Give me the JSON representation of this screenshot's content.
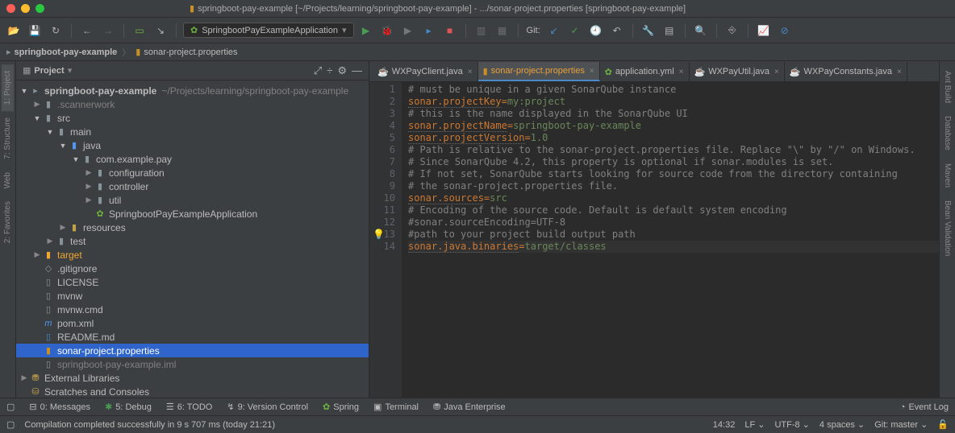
{
  "window": {
    "title": "springboot-pay-example [~/Projects/learning/springboot-pay-example] - .../sonar-project.properties [springboot-pay-example]"
  },
  "runConfig": "SpringbootPayExampleApplication",
  "gitLabel": "Git:",
  "breadcrumb": {
    "root": "springboot-pay-example",
    "file": "sonar-project.properties"
  },
  "sidebar": {
    "title": "Project",
    "tree": {
      "project": "springboot-pay-example",
      "projectPath": "~/Projects/learning/springboot-pay-example",
      "scannerwork": ".scannerwork",
      "src": "src",
      "main": "main",
      "java": "java",
      "pkg": "com.example.pay",
      "configuration": "configuration",
      "controller": "controller",
      "util": "util",
      "app": "SpringbootPayExampleApplication",
      "resources": "resources",
      "test": "test",
      "target": "target",
      "gitignore": ".gitignore",
      "license": "LICENSE",
      "mvnw": "mvnw",
      "mvnwcmd": "mvnw.cmd",
      "pom": "pom.xml",
      "readme": "README.md",
      "sonar": "sonar-project.properties",
      "iml": "springboot-pay-example.iml",
      "extlib": "External Libraries",
      "scratches": "Scratches and Consoles"
    }
  },
  "tabs": [
    {
      "label": "WXPayClient.java"
    },
    {
      "label": "sonar-project.properties"
    },
    {
      "label": "application.yml"
    },
    {
      "label": "WXPayUtil.java"
    },
    {
      "label": "WXPayConstants.java"
    }
  ],
  "editor": {
    "lines": [
      {
        "n": 1,
        "type": "comment",
        "text": "# must be unique in a given SonarQube instance"
      },
      {
        "n": 2,
        "type": "kv",
        "key": "sonar.projectKey",
        "val": "my:project"
      },
      {
        "n": 3,
        "type": "comment",
        "text": "# this is the name displayed in the SonarQube UI"
      },
      {
        "n": 4,
        "type": "kv",
        "key": "sonar.projectName",
        "val": "springboot-pay-example"
      },
      {
        "n": 5,
        "type": "kv",
        "key": "sonar.projectVersion",
        "val": "1.0"
      },
      {
        "n": 6,
        "type": "comment",
        "text": "# Path is relative to the sonar-project.properties file. Replace \"\\\" by \"/\" on Windows."
      },
      {
        "n": 7,
        "type": "comment",
        "text": "# Since SonarQube 4.2, this property is optional if sonar.modules is set."
      },
      {
        "n": 8,
        "type": "comment",
        "text": "# If not set, SonarQube starts looking for source code from the directory containing"
      },
      {
        "n": 9,
        "type": "comment",
        "text": "# the sonar-project.properties file."
      },
      {
        "n": 10,
        "type": "kv",
        "key": "sonar.sources",
        "val": "src"
      },
      {
        "n": 11,
        "type": "comment",
        "text": "# Encoding of the source code. Default is default system encoding"
      },
      {
        "n": 12,
        "type": "comment",
        "text": "#sonar.sourceEncoding=UTF-8"
      },
      {
        "n": 13,
        "type": "comment",
        "text": "#path to your project build output path",
        "bulb": true
      },
      {
        "n": 14,
        "type": "kv",
        "key": "sonar.java.binaries",
        "val": "target/classes",
        "hl": true
      }
    ]
  },
  "leftPanels": [
    "1: Project",
    "7: Structure",
    "Web",
    "2: Favorites"
  ],
  "rightPanels": [
    "Ant Build",
    "Database",
    "Maven",
    "Bean Validation"
  ],
  "bottomBar": {
    "messages": "0: Messages",
    "debug": "5: Debug",
    "todo": "6: TODO",
    "version": "9: Version Control",
    "spring": "Spring",
    "terminal": "Terminal",
    "jee": "Java Enterprise",
    "eventlog": "Event Log"
  },
  "status": {
    "msg": "Compilation completed successfully in 9 s 707 ms (today 21:21)",
    "pos": "14:32",
    "le": "LF",
    "enc": "UTF-8",
    "indent": "4 spaces",
    "git": "Git: master"
  }
}
